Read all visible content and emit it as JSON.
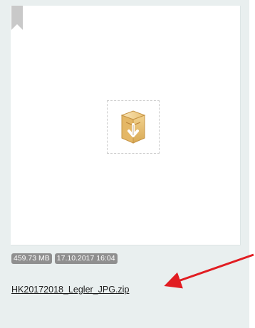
{
  "file": {
    "size": "459.73 MB",
    "date": "17.10.2017 16:04",
    "name": "HK20172018_Legler_JPG.zip"
  },
  "icons": {
    "bookmark": "bookmark-icon",
    "file": "archive-box-icon",
    "annotation": "red-arrow-icon"
  },
  "colors": {
    "card_background": "#e9efef",
    "preview_background": "#ffffff",
    "badge_background": "#8f8f8f",
    "badge_text": "#ffffff",
    "link_text": "#1d1d1d",
    "arrow": "#e11d22"
  }
}
